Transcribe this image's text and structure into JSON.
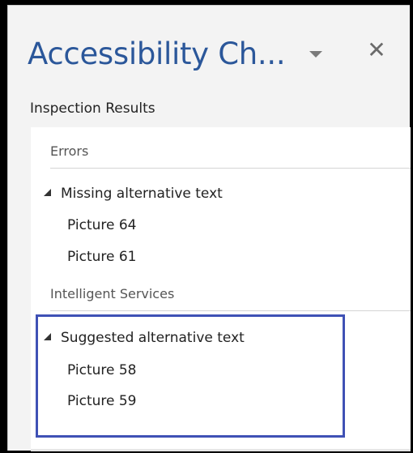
{
  "pane": {
    "title": "Accessibility Ch...",
    "dropdown_icon": "triangle-down-icon",
    "close_icon": "close-icon",
    "close_glyph": "✕",
    "subtitle": "Inspection Results"
  },
  "sections": [
    {
      "header": "Errors",
      "group": {
        "label": "Missing alternative text",
        "expanded": true,
        "items": [
          "Picture 64",
          "Picture 61"
        ]
      }
    },
    {
      "header": "Intelligent Services",
      "group": {
        "label": "Suggested alternative text",
        "expanded": true,
        "items": [
          "Picture 58",
          "Picture 59"
        ]
      }
    }
  ],
  "colors": {
    "title": "#2b579a",
    "highlight": "#3f51b5"
  }
}
